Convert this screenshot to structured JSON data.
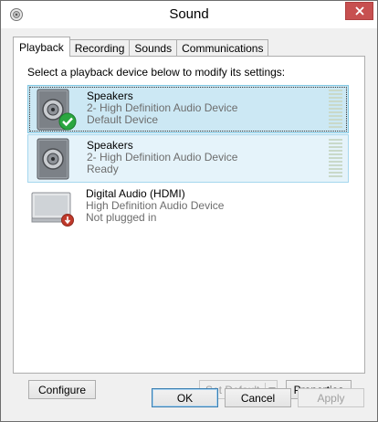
{
  "window": {
    "title": "Sound",
    "app_icon": "speaker-app-icon",
    "close_icon": "close-icon"
  },
  "tabs": [
    {
      "label": "Playback",
      "active": true
    },
    {
      "label": "Recording",
      "active": false
    },
    {
      "label": "Sounds",
      "active": false
    },
    {
      "label": "Communications",
      "active": false
    }
  ],
  "playback": {
    "instruction": "Select a playback device below to modify its settings:",
    "devices": [
      {
        "name": "Speakers",
        "description": "2- High Definition Audio Device",
        "status": "Default Device",
        "icon": "speaker-icon",
        "badge": "check-badge-icon",
        "state": "selected"
      },
      {
        "name": "Speakers",
        "description": "2- High Definition Audio Device",
        "status": "Ready",
        "icon": "speaker-icon",
        "badge": "",
        "state": "hover"
      },
      {
        "name": "Digital Audio (HDMI)",
        "description": "High Definition Audio Device",
        "status": "Not plugged in",
        "icon": "monitor-icon",
        "badge": "unplugged-badge-icon",
        "state": "normal"
      }
    ],
    "buttons": {
      "configure": "Configure",
      "set_default": "Set Default",
      "properties": "Properties"
    }
  },
  "dialog_buttons": {
    "ok": "OK",
    "cancel": "Cancel",
    "apply": "Apply"
  },
  "colors": {
    "selected_bg": "#cce8f4",
    "hover_bg": "#e5f3fa",
    "close_red": "#c75050",
    "check_green": "#2aa640"
  }
}
